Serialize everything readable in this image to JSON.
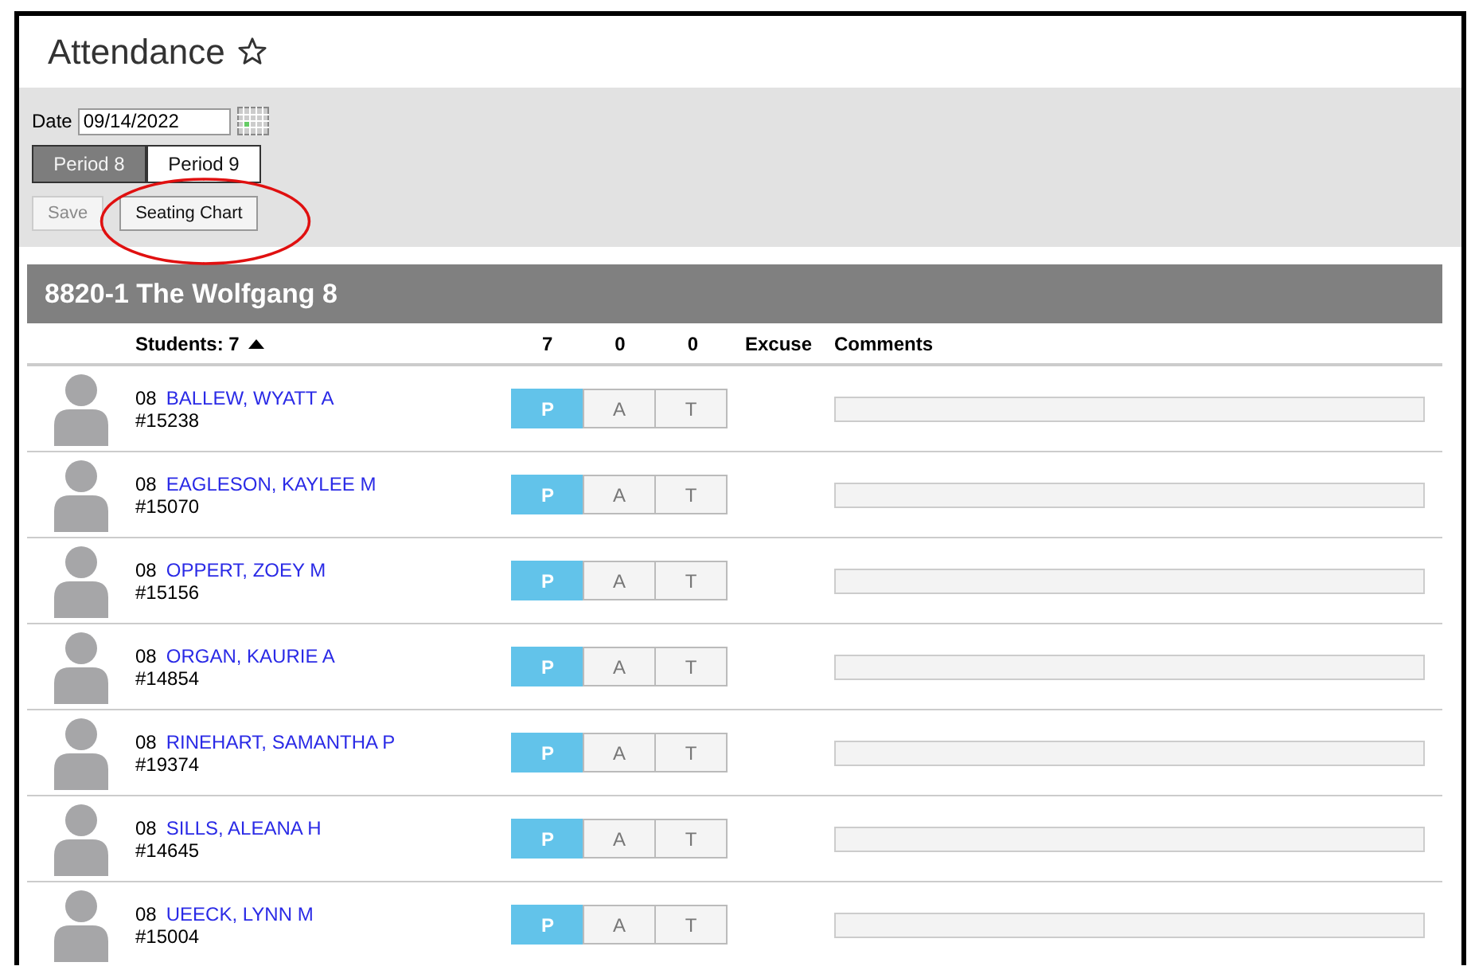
{
  "page": {
    "title": "Attendance"
  },
  "date": {
    "label": "Date",
    "value": "09/14/2022"
  },
  "periods": [
    {
      "label": "Period 8",
      "selected": true
    },
    {
      "label": "Period 9",
      "selected": false
    }
  ],
  "buttons": [
    {
      "label": "Save",
      "disabled": true
    },
    {
      "label": "Seating Chart",
      "disabled": false
    }
  ],
  "section": {
    "title": "8820-1 The Wolfgang 8"
  },
  "columns": {
    "students": "Students: 7",
    "present": "7",
    "absent": "0",
    "tardy": "0",
    "excuse": "Excuse",
    "comments": "Comments"
  },
  "students": [
    {
      "grade": "08",
      "name": "BALLEW, WYATT A",
      "id": "#15238",
      "marks": [
        {
          "label": "P",
          "selected": true
        },
        {
          "label": "A",
          "selected": false
        },
        {
          "label": "T",
          "selected": false
        }
      ]
    },
    {
      "grade": "08",
      "name": "EAGLESON, KAYLEE M",
      "id": "#15070",
      "marks": [
        {
          "label": "P",
          "selected": true
        },
        {
          "label": "A",
          "selected": false
        },
        {
          "label": "T",
          "selected": false
        }
      ]
    },
    {
      "grade": "08",
      "name": "OPPERT, ZOEY M",
      "id": "#15156",
      "marks": [
        {
          "label": "P",
          "selected": true
        },
        {
          "label": "A",
          "selected": false
        },
        {
          "label": "T",
          "selected": false
        }
      ]
    },
    {
      "grade": "08",
      "name": "ORGAN, KAURIE A",
      "id": "#14854",
      "marks": [
        {
          "label": "P",
          "selected": true
        },
        {
          "label": "A",
          "selected": false
        },
        {
          "label": "T",
          "selected": false
        }
      ]
    },
    {
      "grade": "08",
      "name": "RINEHART, SAMANTHA P",
      "id": "#19374",
      "marks": [
        {
          "label": "P",
          "selected": true
        },
        {
          "label": "A",
          "selected": false
        },
        {
          "label": "T",
          "selected": false
        }
      ]
    },
    {
      "grade": "08",
      "name": "SILLS, ALEANA H",
      "id": "#14645",
      "marks": [
        {
          "label": "P",
          "selected": true
        },
        {
          "label": "A",
          "selected": false
        },
        {
          "label": "T",
          "selected": false
        }
      ]
    },
    {
      "grade": "08",
      "name": "UEECK, LYNN M",
      "id": "#15004",
      "marks": [
        {
          "label": "P",
          "selected": true
        },
        {
          "label": "A",
          "selected": false
        },
        {
          "label": "T",
          "selected": false
        }
      ]
    }
  ]
}
